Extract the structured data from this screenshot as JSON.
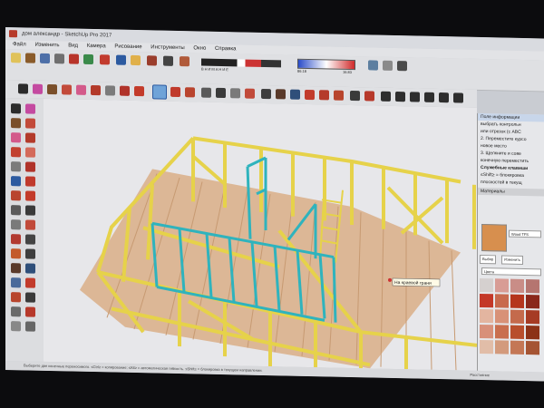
{
  "window": {
    "title": "дом александр - SketchUp Pro 2017"
  },
  "menu": [
    "Файл",
    "Изменить",
    "Вид",
    "Камера",
    "Рисование",
    "Инструменты",
    "Окно",
    "Справка"
  ],
  "toolbar": {
    "legend_caption": "ВНИМАНИЕ",
    "scale_min": "86.18",
    "scale_max": "16.83",
    "icons": [
      "select-icon",
      "eraser-icon",
      "paint-icon",
      "line-icon",
      "rectangle-icon",
      "circle-icon",
      "push-pull-icon",
      "move-icon",
      "rotate-icon",
      "scale-icon",
      "offset-icon",
      "tape-icon",
      "text-icon",
      "orbit-icon",
      "pan-icon",
      "zoom-icon",
      "zoom-extents-icon",
      "camera-icon"
    ]
  },
  "left_toolbar": {
    "icons": [
      "select-icon",
      "eraser-icon",
      "pencil-icon",
      "arc-icon",
      "rectangle-icon",
      "circle-icon",
      "polygon-icon",
      "freehand-icon",
      "push-pull-icon",
      "follow-me-icon",
      "move-icon",
      "rotate-icon",
      "scale-icon",
      "offset-icon",
      "tape-icon",
      "dimension-icon",
      "protractor-icon",
      "text-icon",
      "axes-icon",
      "3d-text-icon",
      "paint-icon",
      "orbit-icon",
      "pan-icon",
      "zoom-icon",
      "zoom-window-icon",
      "zoom-extents-icon",
      "position-camera-icon",
      "walk-icon",
      "look-around-icon",
      "section-icon"
    ]
  },
  "viewport": {
    "tooltip": "На краевой грани"
  },
  "tray": {
    "header": "Поле информации",
    "lines": [
      "выбрать контрольн",
      "или отрезок (с ABC",
      "2. Переместите курсо",
      "новое место",
      "3. Щелкните и сове",
      "конечную переместить"
    ],
    "helper_title": "Служебные клавиши",
    "helper_lines": [
      "≤Shift≥ = блокировка",
      "плоскостей в текущ"
    ],
    "materials_header": "Материалы",
    "material_name": "Wood TFS",
    "material_tabs": [
      "Выбор",
      "Изменить"
    ],
    "category": "Цвета",
    "palette": [
      "#d5d0cf",
      "#d89c95",
      "#c98d87",
      "#b57570",
      "#c43828",
      "#c86a4e",
      "#b5351d",
      "#8a271b",
      "#e3b5a0",
      "#d89177",
      "#c46a4c",
      "#a63b24",
      "#d8907a",
      "#c96e4e",
      "#b84e2c",
      "#8c3217",
      "#e1bda8",
      "#d39a7c",
      "#c47755",
      "#a55433"
    ]
  },
  "status": {
    "text": "Выберите две конечные переносимого. ≤Ctrl≥ = копирование; ≤Alt≥ = автоматическая гибкость. ≤Shift≥ = блокировка в текущем направлении.",
    "measure_label": "Расстояние"
  }
}
